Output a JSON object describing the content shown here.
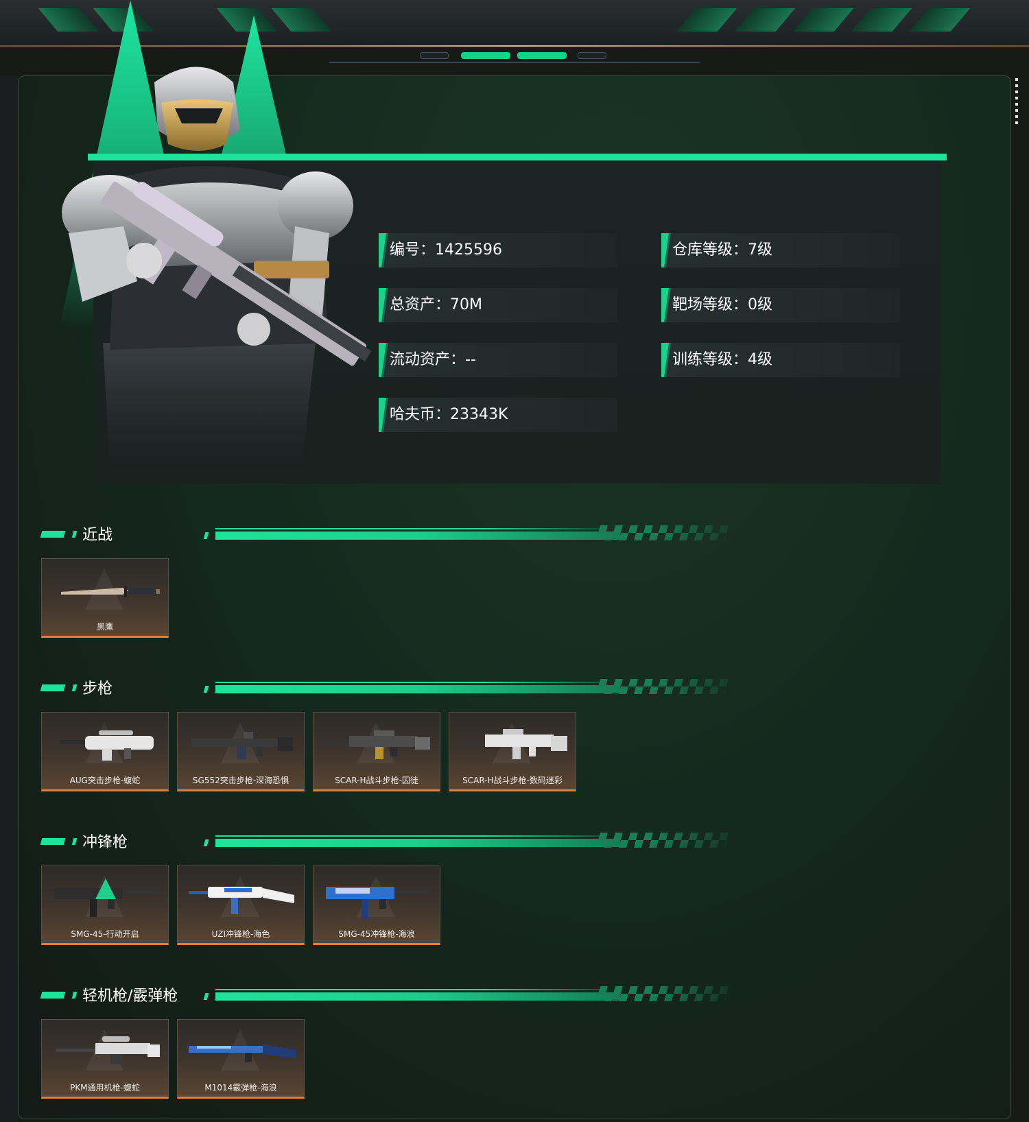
{
  "colors": {
    "accent": "#1fe39a",
    "card_bottom_border": "#e0803a",
    "background": "#161b17"
  },
  "profile": {
    "stats_left": [
      {
        "label": "编号：1425596"
      },
      {
        "label": "总资产：70M"
      },
      {
        "label": "流动资产：--"
      },
      {
        "label": "哈夫币：23343K"
      }
    ],
    "stats_right": [
      {
        "label": "仓库等级：7级"
      },
      {
        "label": "靶场等级：0级"
      },
      {
        "label": "训练等级：4级"
      }
    ]
  },
  "sections": [
    {
      "title": "近战",
      "items": [
        {
          "name": "黑鹰",
          "icon": "knife-icon"
        }
      ]
    },
    {
      "title": "步枪",
      "items": [
        {
          "name": "AUG突击步枪-蝮蛇",
          "icon": "rifle-icon"
        },
        {
          "name": "SG552突击步枪-深海恐惧",
          "icon": "rifle-icon"
        },
        {
          "name": "SCAR-H战斗步枪-囚徒",
          "icon": "rifle-icon"
        },
        {
          "name": "SCAR-H战斗步枪-数码迷彩",
          "icon": "rifle-icon"
        }
      ]
    },
    {
      "title": "冲锋枪",
      "items": [
        {
          "name": "SMG-45-行动开启",
          "icon": "smg-icon"
        },
        {
          "name": "UZI冲锋枪-海色",
          "icon": "smg-icon"
        },
        {
          "name": "SMG-45冲锋枪-海浪",
          "icon": "smg-icon"
        }
      ]
    },
    {
      "title": "轻机枪/霰弹枪",
      "items": [
        {
          "name": "PKM通用机枪-蝮蛇",
          "icon": "machine-gun-icon"
        },
        {
          "name": "M1014霰弹枪-海浪",
          "icon": "shotgun-icon"
        }
      ]
    }
  ]
}
